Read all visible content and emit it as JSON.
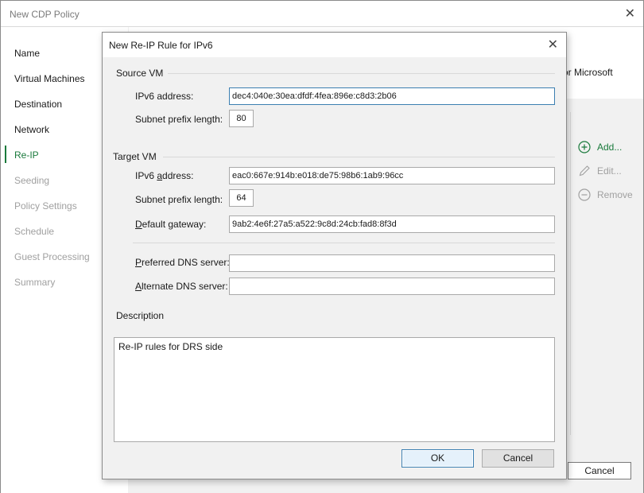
{
  "main_window": {
    "title": "New CDP Policy",
    "close_glyph": "✕",
    "partial_text": "or Microsoft",
    "cancel_label": "Cancel"
  },
  "sidebar": {
    "items": [
      {
        "label": "Name",
        "state": "normal"
      },
      {
        "label": "Virtual Machines",
        "state": "normal"
      },
      {
        "label": "Destination",
        "state": "normal"
      },
      {
        "label": "Network",
        "state": "normal"
      },
      {
        "label": "Re-IP",
        "state": "active"
      },
      {
        "label": "Seeding",
        "state": "disabled"
      },
      {
        "label": "Policy Settings",
        "state": "disabled"
      },
      {
        "label": "Schedule",
        "state": "disabled"
      },
      {
        "label": "Guest Processing",
        "state": "disabled"
      },
      {
        "label": "Summary",
        "state": "disabled"
      }
    ]
  },
  "right_actions": {
    "add_label": "Add...",
    "edit_label": "Edit...",
    "remove_label": "Remove"
  },
  "dialog": {
    "title": "New Re-IP Rule for IPv6",
    "close_glyph": "✕",
    "source_vm": {
      "group_label": "Source VM",
      "ipv6_label": "IPv6 address:",
      "ipv6_value": "dec4:040e:30ea:dfdf:4fea:896e:c8d3:2b06",
      "prefix_label": "Subnet prefix length:",
      "prefix_value": "80"
    },
    "target_vm": {
      "group_label": "Target VM",
      "ipv6_label_pre": "IPv6 ",
      "ipv6_label_key": "a",
      "ipv6_label_post": "ddress:",
      "ipv6_value": "eac0:667e:914b:e018:de75:98b6:1ab9:96cc",
      "prefix_label": "Subnet prefix length:",
      "prefix_value": "64",
      "gateway_label_key": "D",
      "gateway_label_post": "efault gateway:",
      "gateway_value": "9ab2:4e6f:27a5:a522:9c8d:24cb:fad8:8f3d",
      "preferred_dns_key": "P",
      "preferred_dns_post": "referred DNS server:",
      "preferred_dns_value": "",
      "alternate_dns_key": "A",
      "alternate_dns_post": "lternate DNS server:",
      "alternate_dns_value": ""
    },
    "description": {
      "group_label": "Description",
      "value": "Re-IP rules for DRS side"
    },
    "ok_label": "OK",
    "cancel_label": "Cancel"
  },
  "colors": {
    "accent_green": "#1a7a3c",
    "focus_blue": "#3c7fb1",
    "disabled_gray": "#a0a0a0"
  },
  "icons": {
    "add": "plus-circle-icon",
    "edit": "pencil-icon",
    "remove": "minus-circle-icon"
  }
}
